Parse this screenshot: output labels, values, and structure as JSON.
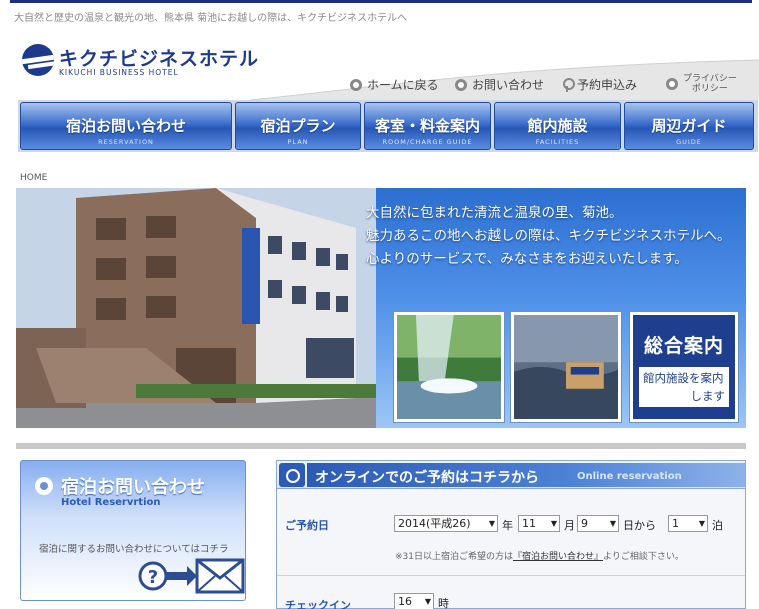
{
  "header": {
    "tagline": "大自然と歴史の温泉と観光の地、熊本県 菊池にお越しの際は、キクチビジネスホテルへ",
    "logo_jp": "キクチビジネスホテル",
    "logo_en": "KIKUCHI BUSINESS HOTEL",
    "subnav": [
      {
        "label": "ホームに戻る",
        "icon": "circle-bullet-icon"
      },
      {
        "label": "お問い合わせ",
        "icon": "circle-bullet-icon"
      },
      {
        "label": "予約申込み",
        "icon": "pin-icon"
      },
      {
        "label_line1": "プライバシー",
        "label_line2": "ポリシー",
        "icon": "circle-bullet-icon"
      }
    ]
  },
  "gnav": [
    {
      "jp": "宿泊お問い合わせ",
      "en": "RESERVATION"
    },
    {
      "jp": "宿泊プラン",
      "en": "PLAN"
    },
    {
      "jp": "客室・料金案内",
      "en": "ROOM/CHARGE GUIDE"
    },
    {
      "jp": "館内施設",
      "en": "FACILITIES"
    },
    {
      "jp": "周辺ガイド",
      "en": "GUIDE"
    }
  ],
  "breadcrumb": "HOME",
  "hero": {
    "line1": "大自然に包まれた清流と温泉の里、菊池。",
    "line2": "魅力あるこの地へお越しの際は、キクチビジネスホテルへ。",
    "line3": "心よりのサービスで、みなさまをお迎えいたします。",
    "building_sign": "キクチビジネスホテル",
    "guide_title": "総合案内",
    "guide_sub_line1": "館内施設を案内",
    "guide_sub_line2": "します"
  },
  "sidebar": {
    "title": "宿泊お問い合わせ",
    "subtitle": "Hotel Reservrtion",
    "description": "宿泊に関するお問い合わせについてはコチラ"
  },
  "reservation": {
    "title": "オンラインでのご予約はコチラから",
    "title_en": "Online reservation",
    "date_label": "ご予約日",
    "year_value": "2014(平成26)",
    "year_unit": "年",
    "month_value": "11",
    "month_unit": "月",
    "day_value": "9",
    "day_unit": "日から",
    "nights_value": "1",
    "nights_unit": "泊",
    "note_prefix": "※31日以上宿泊ご希望の方は",
    "note_link": "『宿泊お問い合わせ』",
    "note_suffix": "よりご相談下さい。",
    "checkin_label": "チェックイン",
    "checkin_value": "16",
    "checkin_unit": "時"
  },
  "colors": {
    "brand_blue": "#1e3a8f",
    "nav_blue": "#2757b6",
    "label_blue": "#2a56b0"
  }
}
